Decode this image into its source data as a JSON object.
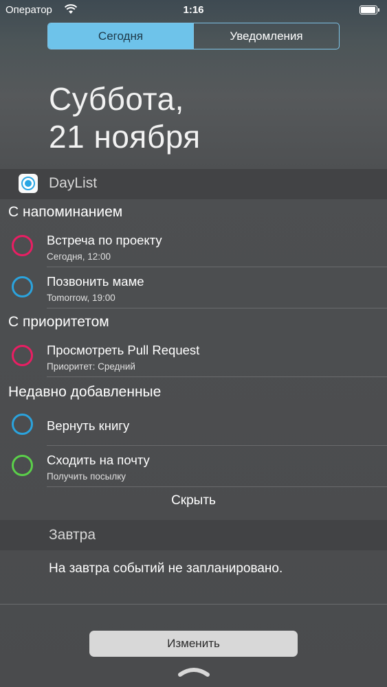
{
  "status_bar": {
    "carrier": "Оператор",
    "time": "1:16",
    "battery_level": 0.95
  },
  "segmented_control": {
    "today": "Сегодня",
    "notifications": "Уведомления",
    "selected": "today"
  },
  "date": {
    "weekday": "Суббота,",
    "day_month": "21 ноября"
  },
  "widget": {
    "app_name": "DayList",
    "groups": [
      {
        "header": "С напоминанием",
        "items": [
          {
            "title": "Встреча по проекту",
            "subtitle": "Сегодня, 12:00",
            "color": "#e91e63"
          },
          {
            "title": "Позвонить маме",
            "subtitle": "Tomorrow, 19:00",
            "color": "#2ba3dd"
          }
        ]
      },
      {
        "header": "С приоритетом",
        "items": [
          {
            "title": "Просмотреть Pull Request",
            "subtitle": "Приоритет: Средний",
            "color": "#e91e63"
          }
        ]
      },
      {
        "header": "Недавно добавленные",
        "items": [
          {
            "title": "Вернуть книгу",
            "subtitle": "",
            "color": "#2ba3dd"
          },
          {
            "title": "Сходить на почту",
            "subtitle": "Получить посылку",
            "color": "#5bd04a"
          }
        ]
      }
    ],
    "hide_label": "Скрыть"
  },
  "tomorrow": {
    "title": "Завтра",
    "empty_text": "На завтра событий не запланировано."
  },
  "edit_button": "Изменить",
  "icons": {
    "wifi": "wifi-icon",
    "battery": "battery-icon",
    "app": "daylist-app-icon",
    "handle": "chevron-up-handle-icon"
  },
  "colors": {
    "accent": "#6ec3ea",
    "pink": "#e91e63",
    "blue": "#2ba3dd",
    "green": "#5bd04a"
  }
}
